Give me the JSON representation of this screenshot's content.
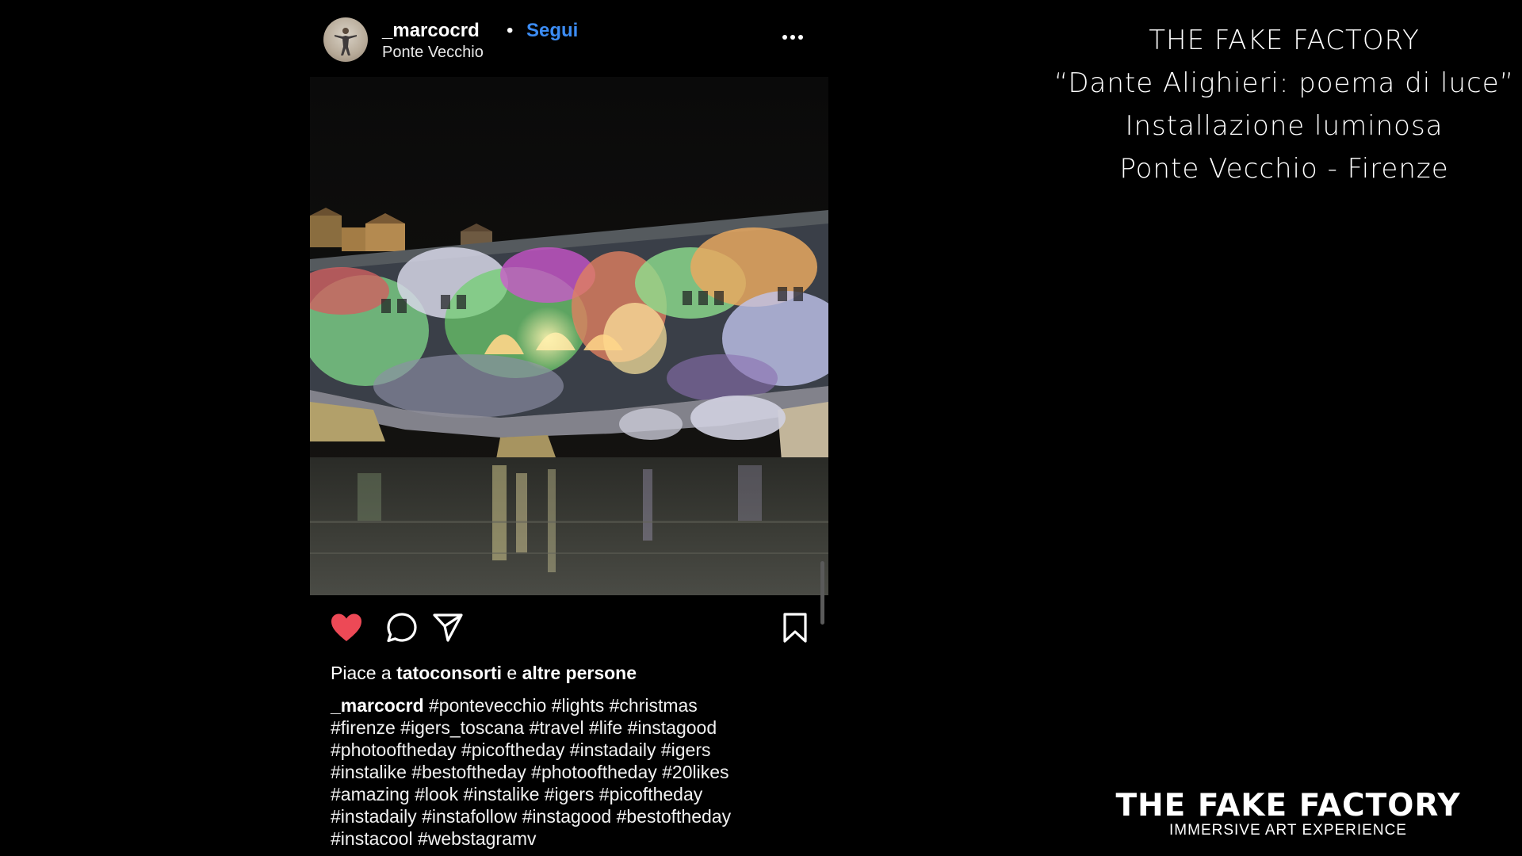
{
  "post": {
    "username": "_marcocrd",
    "separator": "•",
    "follow_label": "Segui",
    "location": "Ponte Vecchio",
    "more_icon": "more-horizontal-icon",
    "photo_icon": "photo",
    "actions": {
      "like_icon": "heart-filled-icon",
      "like_color": "#ed4956",
      "comment_icon": "comment-icon",
      "share_icon": "send-icon",
      "save_icon": "bookmark-icon"
    },
    "likes": {
      "prefix": "Piace a",
      "user": "tatoconsorti",
      "conj": "e",
      "others": "altre persone"
    },
    "caption": {
      "user": "_marcocrd",
      "lines": [
        "#pontevecchio #lights #christmas",
        "#firenze #igers_toscana #travel #life  #instagood",
        "#photooftheday #picoftheday #instadaily #igers",
        "#instalike #bestoftheday #photooftheday #20likes",
        "#amazing #look #instalike #igers #picoftheday",
        "#instadaily #instafollow #instagood #bestoftheday",
        "#instacool #webstagramv"
      ]
    },
    "follow_color": "#3c8cf3"
  },
  "title_block": {
    "line1": "THE FAKE FACTORY",
    "line2": "“Dante Alighieri: poema di luce”",
    "line3": "Installazione luminosa",
    "line4": "Ponte Vecchio - Firenze"
  },
  "brand": {
    "name": "THE FAKE FACTORY",
    "tagline": "IMMERSIVE ART EXPERIENCE"
  }
}
